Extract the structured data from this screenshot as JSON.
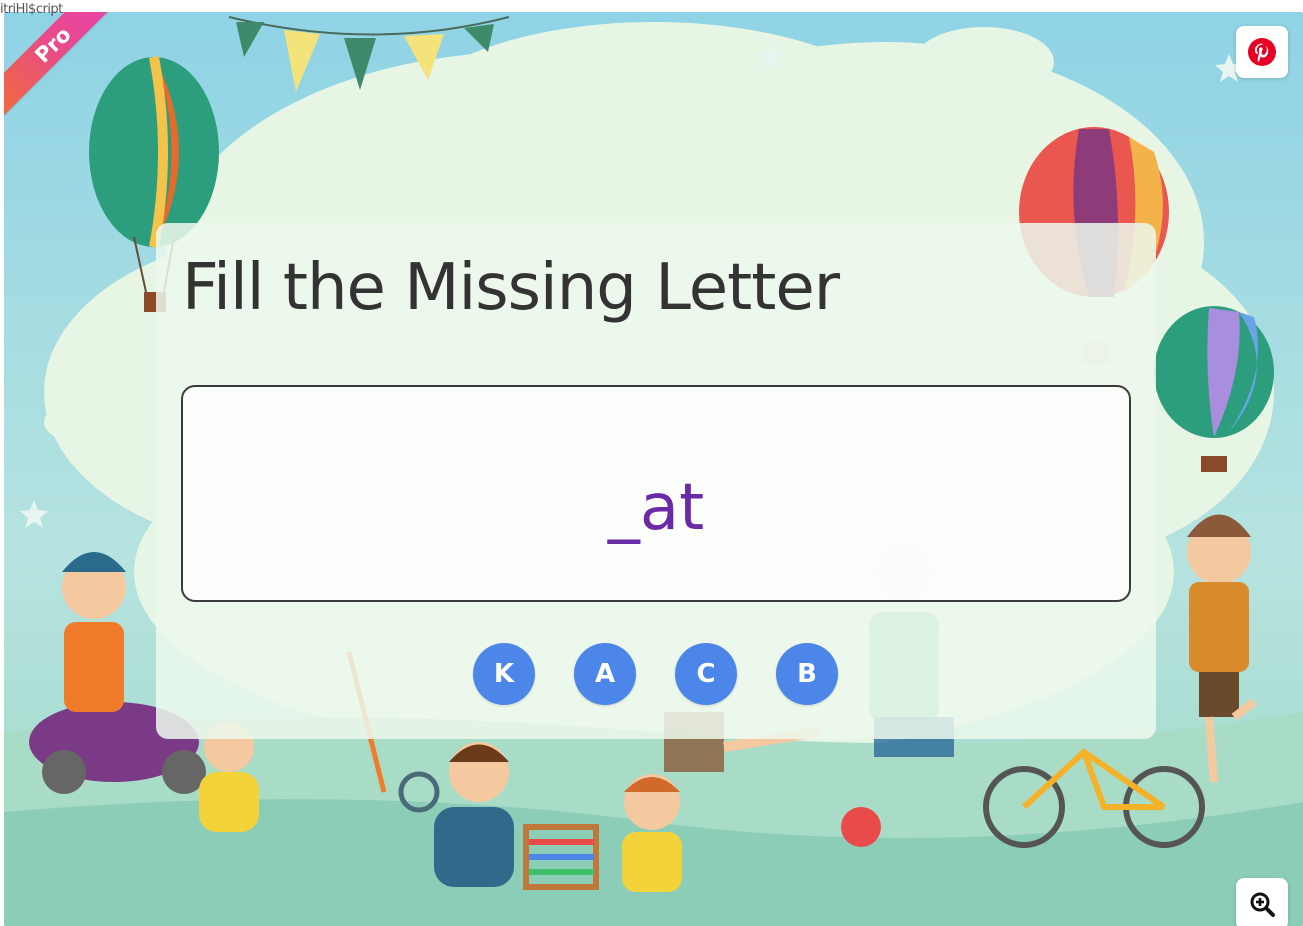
{
  "top_left_overlay_text": "itriHl$cript",
  "badge": {
    "label": "Pro"
  },
  "title": "Fill the Missing Letter",
  "puzzle": {
    "word": "_at"
  },
  "options": [
    {
      "label": "K"
    },
    {
      "label": "A"
    },
    {
      "label": "C"
    },
    {
      "label": "B"
    }
  ],
  "icons": {
    "pinterest": "pinterest-icon",
    "zoom": "zoom-in-icon"
  },
  "colors": {
    "option_button": "#4c86e8",
    "word_text": "#6b2ba6",
    "badge_start": "#f06a3a",
    "badge_end": "#e93fae",
    "pinterest": "#e60023"
  }
}
